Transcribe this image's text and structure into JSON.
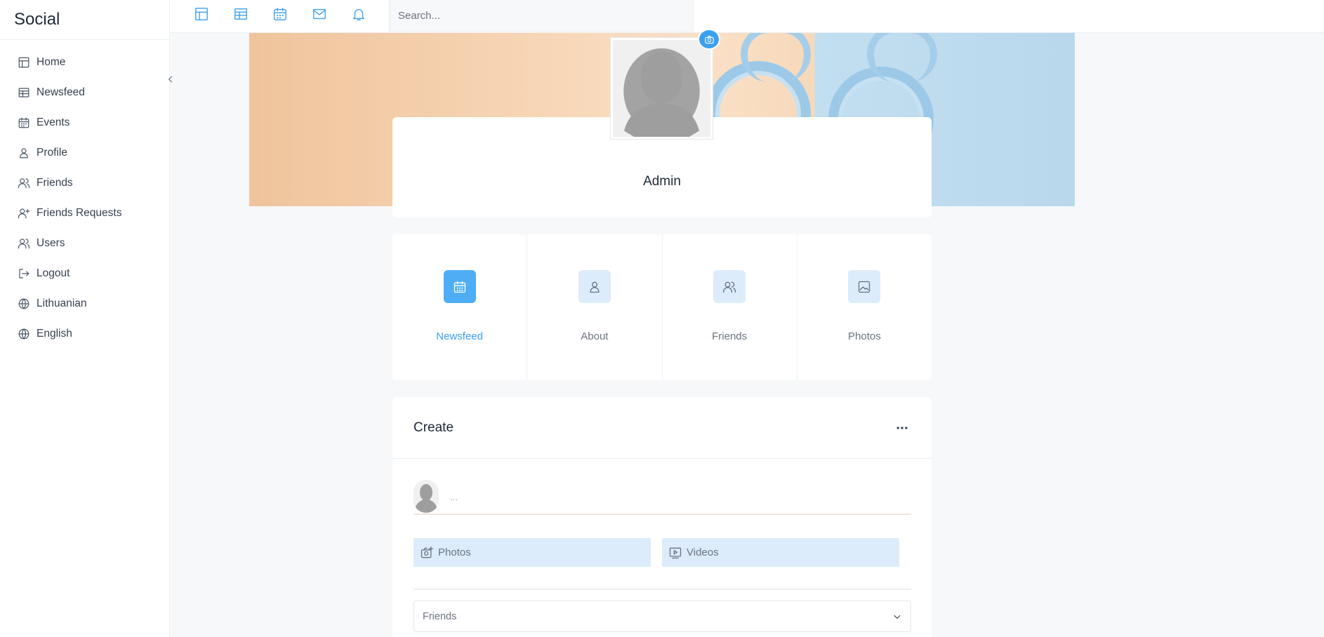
{
  "app": {
    "brand": "Social"
  },
  "sidebar": {
    "items": [
      {
        "label": "Home",
        "icon": "home-icon"
      },
      {
        "label": "Newsfeed",
        "icon": "newsfeed-icon"
      },
      {
        "label": "Events",
        "icon": "calendar-icon"
      },
      {
        "label": "Profile",
        "icon": "user-icon"
      },
      {
        "label": "Friends",
        "icon": "users-icon"
      },
      {
        "label": "Friends Requests",
        "icon": "user-plus-icon"
      },
      {
        "label": "Users",
        "icon": "users-icon"
      },
      {
        "label": "Logout",
        "icon": "logout-icon"
      },
      {
        "label": "Lithuanian",
        "icon": "globe-icon"
      },
      {
        "label": "English",
        "icon": "globe-icon"
      }
    ]
  },
  "topbar": {
    "icons": [
      "home-icon",
      "newsfeed-icon",
      "calendar-icon",
      "mail-icon",
      "bell-icon"
    ],
    "search_placeholder": "Search..."
  },
  "profile": {
    "name": "Admin"
  },
  "tabs": [
    {
      "label": "Newsfeed",
      "icon": "calendar-icon",
      "active": true
    },
    {
      "label": "About",
      "icon": "user-icon",
      "active": false
    },
    {
      "label": "Friends",
      "icon": "users-icon",
      "active": false
    },
    {
      "label": "Photos",
      "icon": "image-icon",
      "active": false
    }
  ],
  "create": {
    "title": "Create",
    "post_placeholder": "...",
    "photos_label": "Photos",
    "videos_label": "Videos",
    "audience_selected": "Friends"
  },
  "colors": {
    "accent": "#3ba0f0",
    "accent_light": "#dcecfb"
  }
}
